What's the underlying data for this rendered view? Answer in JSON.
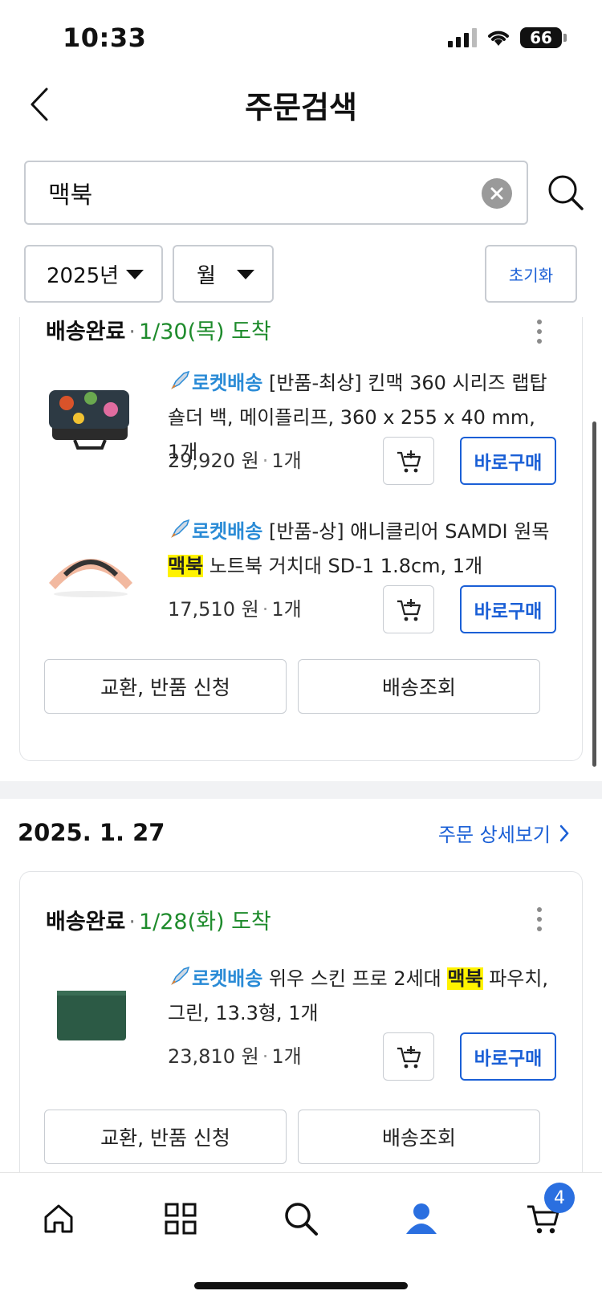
{
  "status_bar": {
    "time": "10:33",
    "battery": "66"
  },
  "header": {
    "title": "주문검색"
  },
  "search": {
    "value": "맥북",
    "placeholder": ""
  },
  "filters": {
    "year": "2025년",
    "month": "월",
    "reset_label": "초기화"
  },
  "orders": [
    {
      "status": "배송완료",
      "arrival": "1/30(목) 도착",
      "items": [
        {
          "shipping_label": "로켓배송",
          "name_before": " [반품-최상] 킨맥 360 시리즈 랩탑 숄더 백, 메이플리프, 360 x 255 x 40 mm, 1개",
          "highlight": "",
          "name_after": "",
          "price": "29,920 원",
          "qty": "1개",
          "buy_label": "바로구매"
        },
        {
          "shipping_label": "로켓배송",
          "name_before": " [반품-상] 애니클리어 SAMDI 원목 ",
          "highlight": "맥북",
          "name_after": " 노트북 거치대 SD-1 1.8cm, 1개",
          "price": "17,510 원",
          "qty": "1개",
          "buy_label": "바로구매"
        }
      ],
      "exchange_label": "교환, 반품 신청",
      "tracking_label": "배송조회"
    },
    {
      "date": "2025. 1. 27",
      "detail_link": "주문 상세보기",
      "status": "배송완료",
      "arrival": "1/28(화) 도착",
      "items": [
        {
          "shipping_label": "로켓배송",
          "name_before": " 위우 스킨 프로 2세대 ",
          "highlight": "맥북",
          "name_after": " 파우치, 그린, 13.3형, 1개",
          "price": "23,810 원",
          "qty": "1개",
          "buy_label": "바로구매"
        }
      ],
      "exchange_label": "교환, 반품 신청",
      "tracking_label": "배송조회"
    }
  ],
  "tab_bar": {
    "cart_badge": "4"
  },
  "colors": {
    "accent": "#1a5fd6",
    "arrival_green": "#1e8b2c",
    "rocket_blue": "#2a8bd6",
    "highlight": "#fff200"
  }
}
